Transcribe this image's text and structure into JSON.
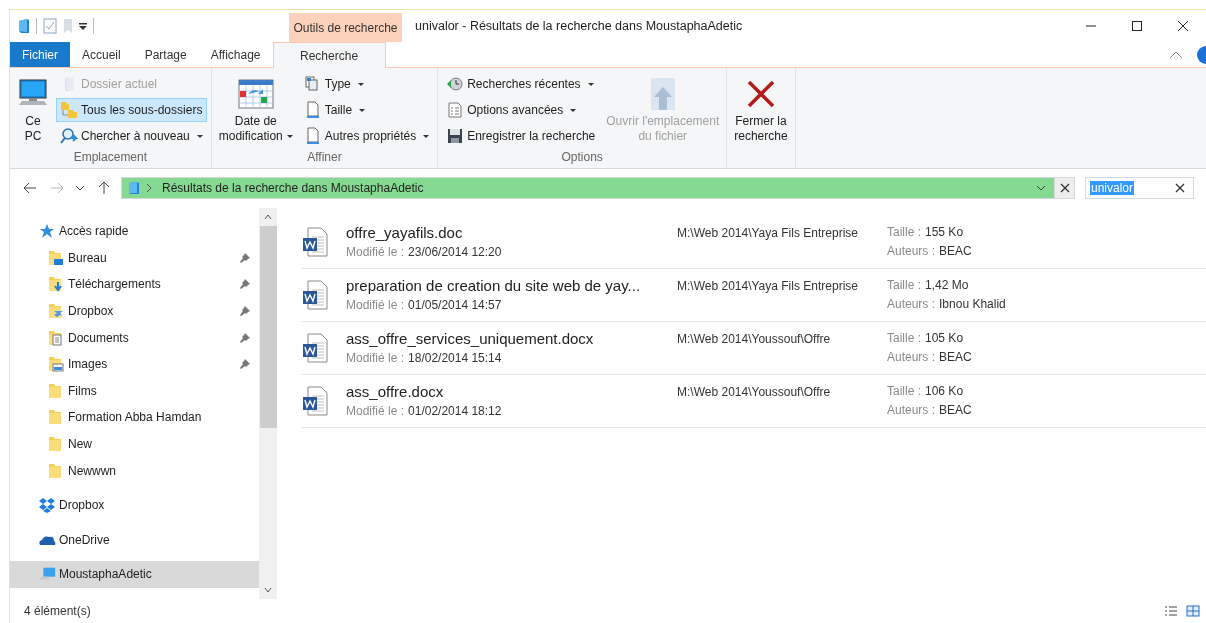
{
  "window": {
    "title": "univalor - Résultats de la recherche dans MoustaphaAdetic"
  },
  "contextual_group": "Outils de recherche",
  "tabs": [
    {
      "label": "Fichier",
      "kind": "file",
      "selected": false
    },
    {
      "label": "Accueil",
      "kind": "normal",
      "selected": false
    },
    {
      "label": "Partage",
      "kind": "normal",
      "selected": false
    },
    {
      "label": "Affichage",
      "kind": "normal",
      "selected": false
    },
    {
      "label": "Recherche",
      "kind": "contextual",
      "selected": true
    }
  ],
  "ribbon": {
    "groups": [
      {
        "label": "Emplacement",
        "items": [
          {
            "kind": "large",
            "label": "Ce\nPC",
            "disabled": false,
            "dropdown": false
          },
          {
            "kind": "small",
            "label": "Dossier actuel",
            "disabled": true,
            "selected": false,
            "dropdown": false
          },
          {
            "kind": "small",
            "label": "Tous les sous-dossiers",
            "disabled": false,
            "selected": true,
            "dropdown": false
          },
          {
            "kind": "small",
            "label": "Chercher à nouveau",
            "disabled": false,
            "selected": false,
            "dropdown": true
          }
        ]
      },
      {
        "label": "Affiner",
        "items": [
          {
            "kind": "large",
            "label": "Date de\nmodification",
            "disabled": false,
            "dropdown": true
          },
          {
            "kind": "small",
            "label": "Type",
            "disabled": false,
            "selected": false,
            "dropdown": true
          },
          {
            "kind": "small",
            "label": "Taille",
            "disabled": false,
            "selected": false,
            "dropdown": true
          },
          {
            "kind": "small",
            "label": "Autres propriétés",
            "disabled": false,
            "selected": false,
            "dropdown": true
          }
        ]
      },
      {
        "label": "Options",
        "items": [
          {
            "kind": "small",
            "label": "Recherches récentes",
            "disabled": false,
            "selected": false,
            "dropdown": true
          },
          {
            "kind": "small",
            "label": "Options avancées",
            "disabled": false,
            "selected": false,
            "dropdown": true
          },
          {
            "kind": "small",
            "label": "Enregistrer la recherche",
            "disabled": false,
            "selected": false,
            "dropdown": false
          },
          {
            "kind": "large",
            "label": "Ouvrir l'emplacement\ndu fichier",
            "disabled": true,
            "dropdown": false
          }
        ]
      },
      {
        "items": [
          {
            "kind": "large",
            "label": "Fermer la\nrecherche",
            "disabled": false,
            "dropdown": false
          }
        ]
      }
    ]
  },
  "address_bar": {
    "path": "Résultats de la recherche dans MoustaphaAdetic",
    "level": 1
  },
  "search": {
    "value": "univalor"
  },
  "sidebar": {
    "items": [
      {
        "label": "Accès rapide",
        "selected": false,
        "children": [
          {
            "label": "Bureau",
            "pinned": true,
            "selected": false
          },
          {
            "label": "Téléchargements",
            "pinned": true,
            "selected": false
          },
          {
            "label": "Dropbox",
            "pinned": true,
            "selected": false
          },
          {
            "label": "Documents",
            "pinned": true,
            "selected": false
          },
          {
            "label": "Images",
            "pinned": true,
            "selected": false
          },
          {
            "label": "Films",
            "pinned": false,
            "selected": false
          },
          {
            "label": "Formation Abba Hamdan",
            "pinned": false,
            "selected": false
          },
          {
            "label": "New",
            "pinned": false,
            "selected": false
          },
          {
            "label": "Newwwn",
            "pinned": false,
            "selected": false
          }
        ]
      },
      {
        "label": "Dropbox",
        "selected": false
      },
      {
        "label": "OneDrive",
        "selected": false
      },
      {
        "label": "MoustaphaAdetic",
        "selected": true
      }
    ]
  },
  "results": [
    {
      "name": "offre_yayafils.doc",
      "modified_label": "Modifié le :",
      "modified": "23/06/2014 12:20",
      "path": "M:\\Web 2014\\Yaya Fils Entreprise",
      "size_label": "Taille :",
      "size": "155 Ko",
      "authors_label": "Auteurs :",
      "authors": "BEAC"
    },
    {
      "name": "preparation de creation du site web de yay...",
      "modified_label": "Modifié le :",
      "modified": "01/05/2014 14:57",
      "path": "M:\\Web 2014\\Yaya Fils Entreprise",
      "size_label": "Taille :",
      "size": "1,42 Mo",
      "authors_label": "Auteurs :",
      "authors": "Ibnou Khalid"
    },
    {
      "name": "ass_offre_services_uniquement.docx",
      "modified_label": "Modifié le :",
      "modified": "18/02/2014 15:14",
      "path": "M:\\Web 2014\\Youssouf\\Offre",
      "size_label": "Taille :",
      "size": "105 Ko",
      "authors_label": "Auteurs :",
      "authors": "BEAC"
    },
    {
      "name": "ass_offre.docx",
      "modified_label": "Modifié le :",
      "modified": "01/02/2014 18:12",
      "path": "M:\\Web 2014\\Youssouf\\Offre",
      "size_label": "Taille :",
      "size": "106 Ko",
      "authors_label": "Auteurs :",
      "authors": "BEAC"
    }
  ],
  "status_bar": {
    "count": "4 élément(s)"
  }
}
